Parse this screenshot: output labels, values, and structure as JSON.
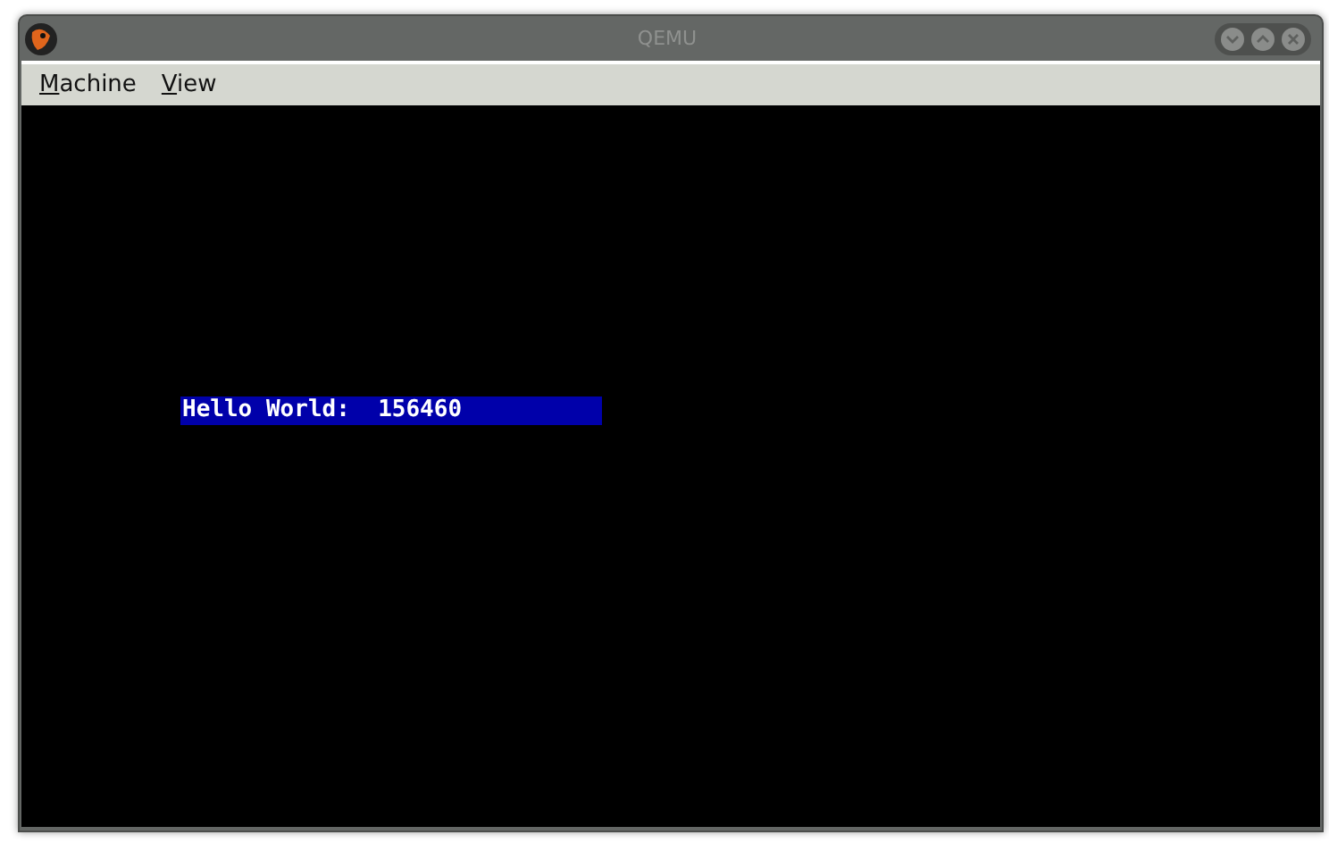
{
  "window": {
    "title": "QEMU"
  },
  "menu": [
    {
      "label": "Machine"
    },
    {
      "label": "View"
    }
  ],
  "screen": {
    "lines": [
      {
        "text": "Hello World:  156460",
        "color": "#0000aa"
      }
    ]
  }
}
